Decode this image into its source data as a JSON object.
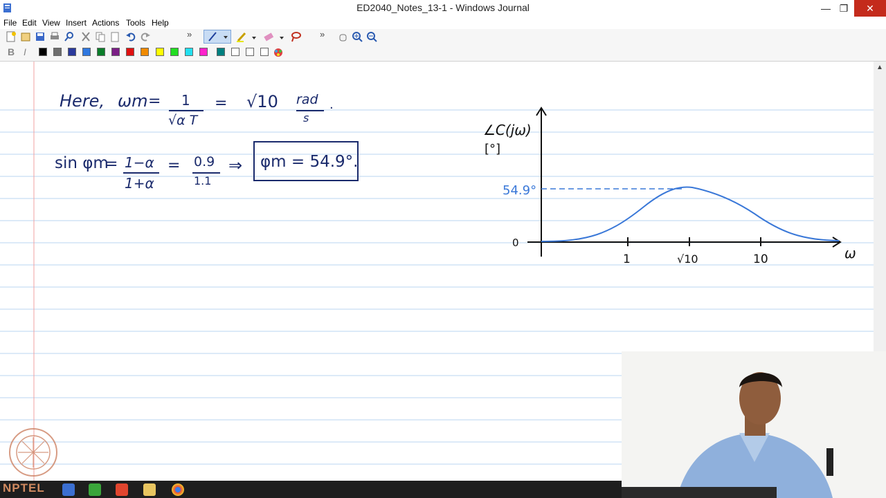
{
  "window": {
    "title": "ED2040_Notes_13-1 - Windows Journal",
    "minimize_glyph": "—",
    "maximize_glyph": "❐",
    "close_glyph": "✕"
  },
  "menu": [
    "File",
    "Edit",
    "View",
    "Insert",
    "Actions",
    "Tools",
    "Help"
  ],
  "toolbar": {
    "overflow_glyph": "»",
    "colors": [
      "#000000",
      "#6e6e6e",
      "#2b3a9c",
      "#2f78e0",
      "#0a7d2a",
      "#7b1f86",
      "#e01010",
      "#f08a00",
      "#ffff00",
      "#22dd22",
      "#22e0f0",
      "#ff22cc",
      "#008080",
      "#ffffff",
      "#ffffff",
      "#ffffff"
    ],
    "bold_label": "B",
    "italic_label": "I"
  },
  "notes": {
    "line1": {
      "here": "Here,",
      "omega_m": "ωm",
      "eq": "=",
      "numerator": "1",
      "denominator": "√α T",
      "eq2": "=",
      "value": "√10",
      "unit_num": "rad",
      "unit_den": "s",
      "period": "."
    },
    "line2": {
      "sin_phi": "sin φm",
      "eq": "=",
      "frac_num": "1−α",
      "frac_den": "1+α",
      "eq2": "=",
      "val_num": "0.9",
      "val_den": "1.1",
      "implies": "⇒",
      "result": "φm = 54.9°."
    }
  },
  "plot": {
    "y_label": "∠C(jω)",
    "y_unit": "[°]",
    "peak_label": "54.9°",
    "zero_label": "0",
    "x_ticks": [
      "1",
      "√10",
      "10"
    ],
    "x_label": "ω"
  },
  "watermark": "NPTEL"
}
